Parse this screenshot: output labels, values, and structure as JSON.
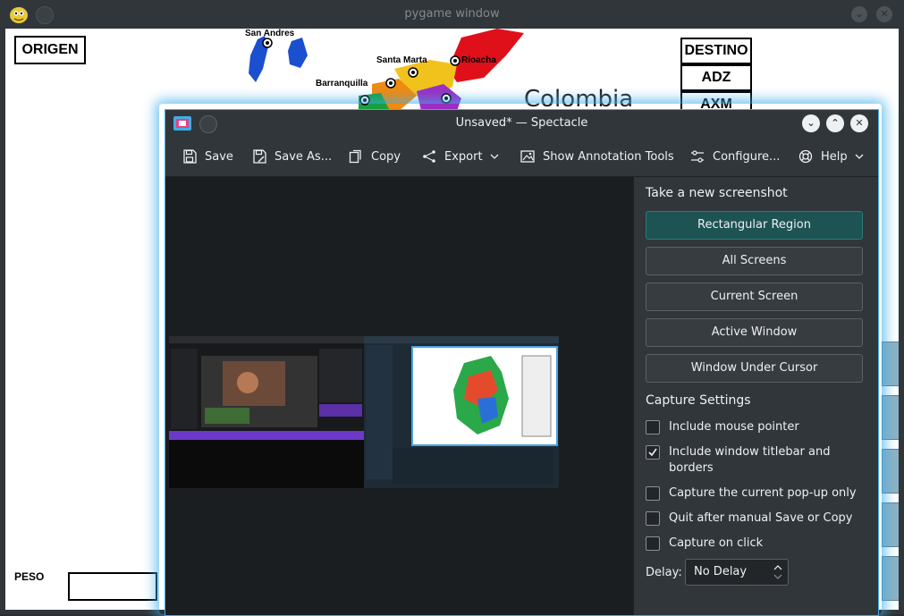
{
  "background_window": {
    "title": "pygame window",
    "origen_label": "ORIGEN",
    "destino_label": "DESTINO",
    "destinations": [
      "ADZ",
      "AXM"
    ],
    "peso_label": "PESO",
    "map_title": "Colombia",
    "cities": [
      "San Andres",
      "Santa Marta",
      "Rioacha",
      "Barranquilla"
    ]
  },
  "spectacle": {
    "title": "Unsaved* — Spectacle",
    "toolbar": {
      "save": "Save",
      "save_as": "Save As...",
      "copy": "Copy",
      "export": "Export",
      "annotation": "Show Annotation Tools",
      "configure": "Configure...",
      "help": "Help"
    },
    "side": {
      "new_screenshot_title": "Take a new screenshot",
      "modes": [
        "Rectangular Region",
        "All Screens",
        "Current Screen",
        "Active Window",
        "Window Under Cursor"
      ],
      "capture_settings_title": "Capture Settings",
      "options": [
        {
          "label": "Include mouse pointer",
          "checked": false
        },
        {
          "label": "Include window titlebar and borders",
          "checked": true
        },
        {
          "label": "Capture the current pop-up only",
          "checked": false
        },
        {
          "label": "Quit after manual Save or Copy",
          "checked": false
        },
        {
          "label": "Capture on click",
          "checked": false
        }
      ],
      "delay_label": "Delay:",
      "delay_value": "No Delay"
    }
  },
  "colors": {
    "accent": "#3daee9",
    "primary_button": "#1d5453",
    "window_bg": "#31363b"
  }
}
